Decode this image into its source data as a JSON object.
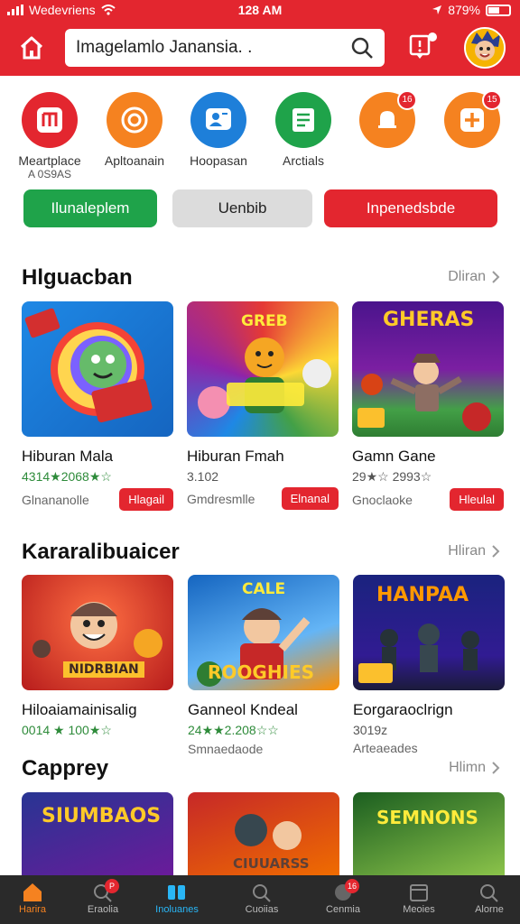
{
  "status": {
    "carrier": "Wedevriens",
    "time": "128 AM",
    "battery": "879%"
  },
  "search": {
    "value": "Imagelamlo Janansia. ."
  },
  "shortcuts": [
    {
      "label": "Meartplace",
      "sub": "A 0S9AS",
      "color": "#e3262f",
      "badge": ""
    },
    {
      "label": "Apltoanain",
      "sub": "",
      "color": "#f58220",
      "badge": ""
    },
    {
      "label": "Hoopasan",
      "sub": "",
      "color": "#1e7fd9",
      "badge": ""
    },
    {
      "label": "Arctials",
      "sub": "",
      "color": "#1fa34a",
      "badge": ""
    },
    {
      "label": "",
      "sub": "",
      "color": "#f58220",
      "badge": "16"
    },
    {
      "label": "",
      "sub": "",
      "color": "#f58220",
      "badge": "15"
    }
  ],
  "filters": [
    "Ilunaleplem",
    "Uenbib",
    "Inpenedsbde"
  ],
  "sections": [
    {
      "title": "Hlguacban",
      "more": "Dliran",
      "cards": [
        {
          "title": "Hiburan Mala",
          "rating": "4314★2068★☆",
          "meta": "Glnananolle",
          "action": "Hlagail"
        },
        {
          "title": "Hiburan Fmah",
          "rating": "3.102",
          "meta": "Gmdresmlle",
          "action": "Elnanal"
        },
        {
          "title": "Gamn Gane",
          "rating": "29★☆ 2993☆",
          "meta": "Gnoclaoke",
          "action": "Hleulal"
        }
      ]
    },
    {
      "title": "Kararalibuaicer",
      "more": "Hliran",
      "cards": [
        {
          "title": "Hiloaiamainisalig",
          "rating": "0014 ★ 100★☆",
          "meta": "",
          "action": ""
        },
        {
          "title": "Ganneol Kndeal",
          "rating": "24★★2.208☆☆",
          "meta": "Smnaedaode",
          "action": ""
        },
        {
          "title": "Eorgaraoclrign",
          "rating": "3019z",
          "meta": "Arteaeades",
          "action": ""
        }
      ]
    },
    {
      "title": "Capprey",
      "more": "Hlimn"
    }
  ],
  "thumb_texts": [
    "",
    "GREB",
    "GHERAS",
    "NIDRBIAN",
    "ROOGHIES",
    "HANPAA",
    "SIUMBAOS",
    "CIUUARSS",
    "SEMNONS"
  ],
  "nav": [
    {
      "label": "Harira",
      "badge": "",
      "active": true
    },
    {
      "label": "Eraolia",
      "badge": "P",
      "active": false
    },
    {
      "label": "Inoluanes",
      "badge": "",
      "active": false
    },
    {
      "label": "Cuoiias",
      "badge": "",
      "active": false
    },
    {
      "label": "Cenmia",
      "badge": "16",
      "active": false
    },
    {
      "label": "Meoies",
      "badge": "",
      "active": false
    },
    {
      "label": "Alorne",
      "badge": "",
      "active": false
    }
  ],
  "colors": {
    "brand": "#e3262f",
    "green": "#1fa34a",
    "rating": "#2e8b3a"
  }
}
